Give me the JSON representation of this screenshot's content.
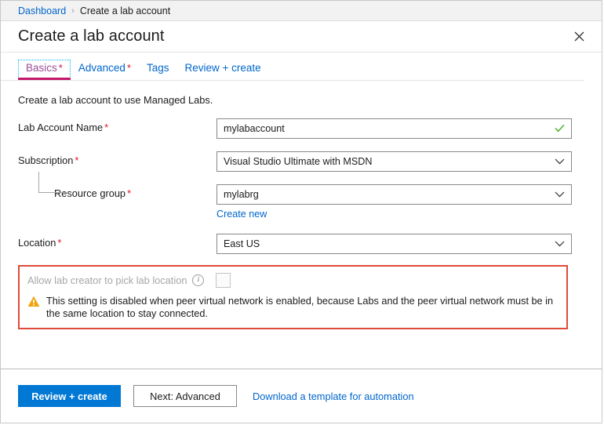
{
  "breadcrumb": {
    "root": "Dashboard",
    "separator": "›",
    "current": "Create a lab account"
  },
  "header": {
    "title": "Create a lab account",
    "close_icon": "close-icon"
  },
  "tabs": [
    {
      "label": "Basics",
      "required_mark": "*",
      "active": true
    },
    {
      "label": "Advanced",
      "required_mark": "*",
      "active": false
    },
    {
      "label": "Tags",
      "required_mark": "",
      "active": false
    },
    {
      "label": "Review + create",
      "required_mark": "",
      "active": false
    }
  ],
  "main": {
    "intro": "Create a lab account to use Managed Labs.",
    "fields": {
      "lab_account_name": {
        "label": "Lab Account Name",
        "required_mark": "*",
        "value": "mylabaccount",
        "validation_icon": "check-icon"
      },
      "subscription": {
        "label": "Subscription",
        "required_mark": "*",
        "value": "Visual Studio Ultimate with MSDN"
      },
      "resource_group": {
        "label": "Resource group",
        "required_mark": "*",
        "value": "mylabrg",
        "create_new_link": "Create new"
      },
      "location": {
        "label": "Location",
        "required_mark": "*",
        "value": "East US"
      }
    },
    "warning_section": {
      "toggle_label": "Allow lab creator to pick lab location",
      "info_icon": "info-icon",
      "checkbox_checked": false,
      "checkbox_disabled": true,
      "warning_icon": "warning-triangle-icon",
      "warning_text": "This setting is disabled when peer virtual network is enabled, because Labs and the peer virtual network must be in the same location to stay connected.",
      "highlight_color": "#e04a3a"
    }
  },
  "footer": {
    "primary_button": "Review + create",
    "secondary_button": "Next: Advanced",
    "template_link": "Download a template for automation"
  },
  "colors": {
    "accent_blue": "#0078d4",
    "link_blue": "#0066cc",
    "required_red": "#e81123",
    "tab_active_magenta": "#c2186b",
    "warning_orange": "#f0a30a",
    "success_green": "#4caf2f"
  }
}
